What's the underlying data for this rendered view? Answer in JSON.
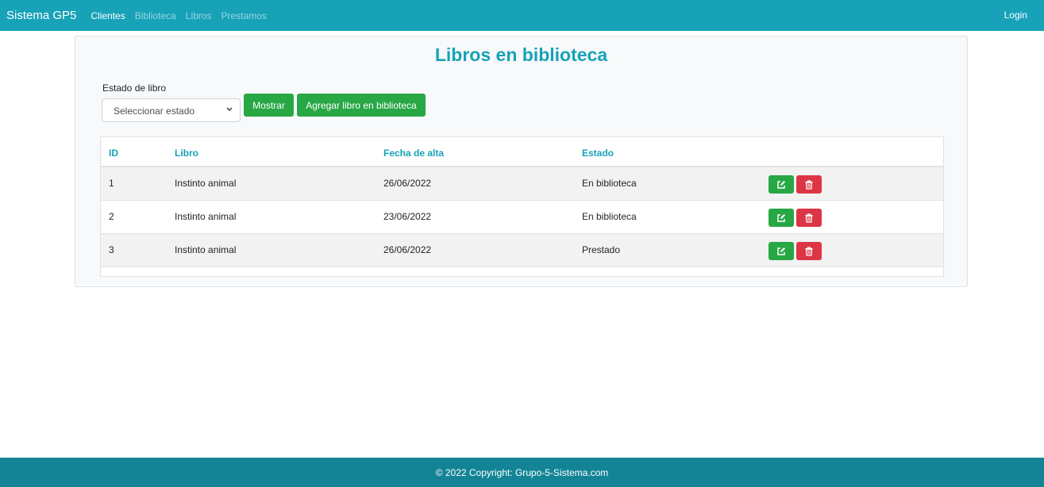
{
  "navbar": {
    "brand": "Sistema GP5",
    "links": [
      {
        "label": "Clientes"
      },
      {
        "label": "Biblioteca"
      },
      {
        "label": "Libros"
      },
      {
        "label": "Prestamos"
      }
    ],
    "login": "Login"
  },
  "main": {
    "title": "Libros en biblioteca",
    "filter": {
      "label": "Estado de libro",
      "select_value": "Seleccionar estado"
    },
    "buttons": {
      "show": "Mostrar",
      "add": "Agregar libro en biblioteca"
    },
    "table": {
      "headers": [
        "ID",
        "Libro",
        "Fecha de alta",
        "Estado"
      ],
      "rows": [
        {
          "id": "1",
          "libro": "Instinto animal",
          "fecha": "26/06/2022",
          "estado": "En biblioteca"
        },
        {
          "id": "2",
          "libro": "Instinto animal",
          "fecha": "23/06/2022",
          "estado": "En biblioteca"
        },
        {
          "id": "3",
          "libro": "Instinto animal",
          "fecha": "26/06/2022",
          "estado": "Prestado"
        }
      ],
      "row_actions": [
        "edit-icon",
        "trash-icon"
      ]
    }
  },
  "footer": {
    "text": "© 2022 Copyright: Grupo-5-Sistema.com"
  },
  "colors": {
    "primary": "#17a2b8",
    "success": "#28a745",
    "danger": "#dc3545",
    "footer": "#138496"
  }
}
